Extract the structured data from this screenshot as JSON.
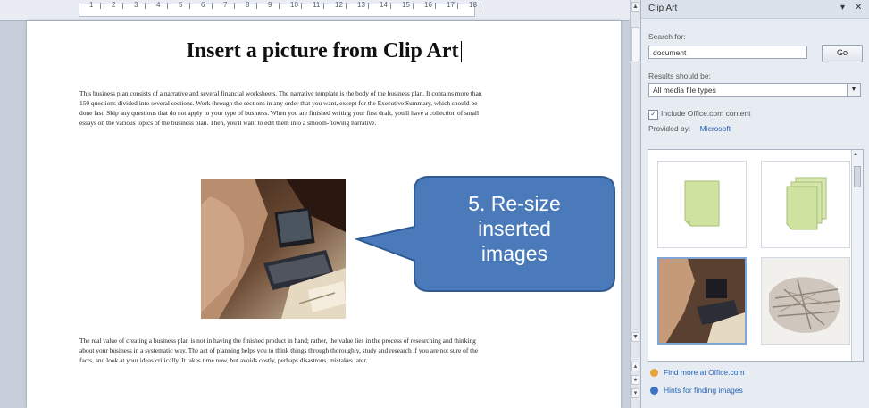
{
  "document": {
    "title": "Insert a picture from Clip Art",
    "paragraph1": "This business plan consists of a narrative and several financial worksheets. The narrative template is the body of the business plan. It contains more than 150 questions divided into several sections. Work through the sections in any order that you want, except for the Executive Summary, which should be done last. Skip any questions that do not apply to your type of business. When you are finished writing your first draft, you'll have a collection of small essays on the various topics of the business plan. Then, you'll want to edit them into a smooth-flowing narrative.",
    "paragraph2": "The real value of creating a business plan is not in having the finished product in hand; rather, the value lies in the process of researching and thinking about your business in a systematic way. The act of planning helps you to think things through thoroughly, study and research if you are not sure of the facts, and look at your ideas critically. It takes time now, but avoids costly, perhaps disastrous, mistakes later."
  },
  "callout": {
    "text_line1": "5. Re-size",
    "text_line2": "inserted",
    "text_line3": "images",
    "color": "#4a7ab9"
  },
  "ruler": {
    "numbers": [
      "1",
      "2",
      "3",
      "4",
      "5",
      "6",
      "7",
      "8",
      "9",
      "10",
      "11",
      "12",
      "13",
      "14",
      "15",
      "16",
      "17",
      "18"
    ]
  },
  "pane": {
    "title": "Clip Art",
    "search_label": "Search for:",
    "search_value": "document",
    "go_label": "Go",
    "results_label": "Results should be:",
    "results_value": "All media file types",
    "include_label": "Include Office.com content",
    "include_checked": "✓",
    "provided_label": "Provided by:",
    "provided_value": "Microsoft",
    "link1": "Find more at Office.com",
    "link2": "Hints for finding images"
  },
  "colors": {
    "accent": "#2563b7",
    "clip_green": "#cfe3a0"
  }
}
